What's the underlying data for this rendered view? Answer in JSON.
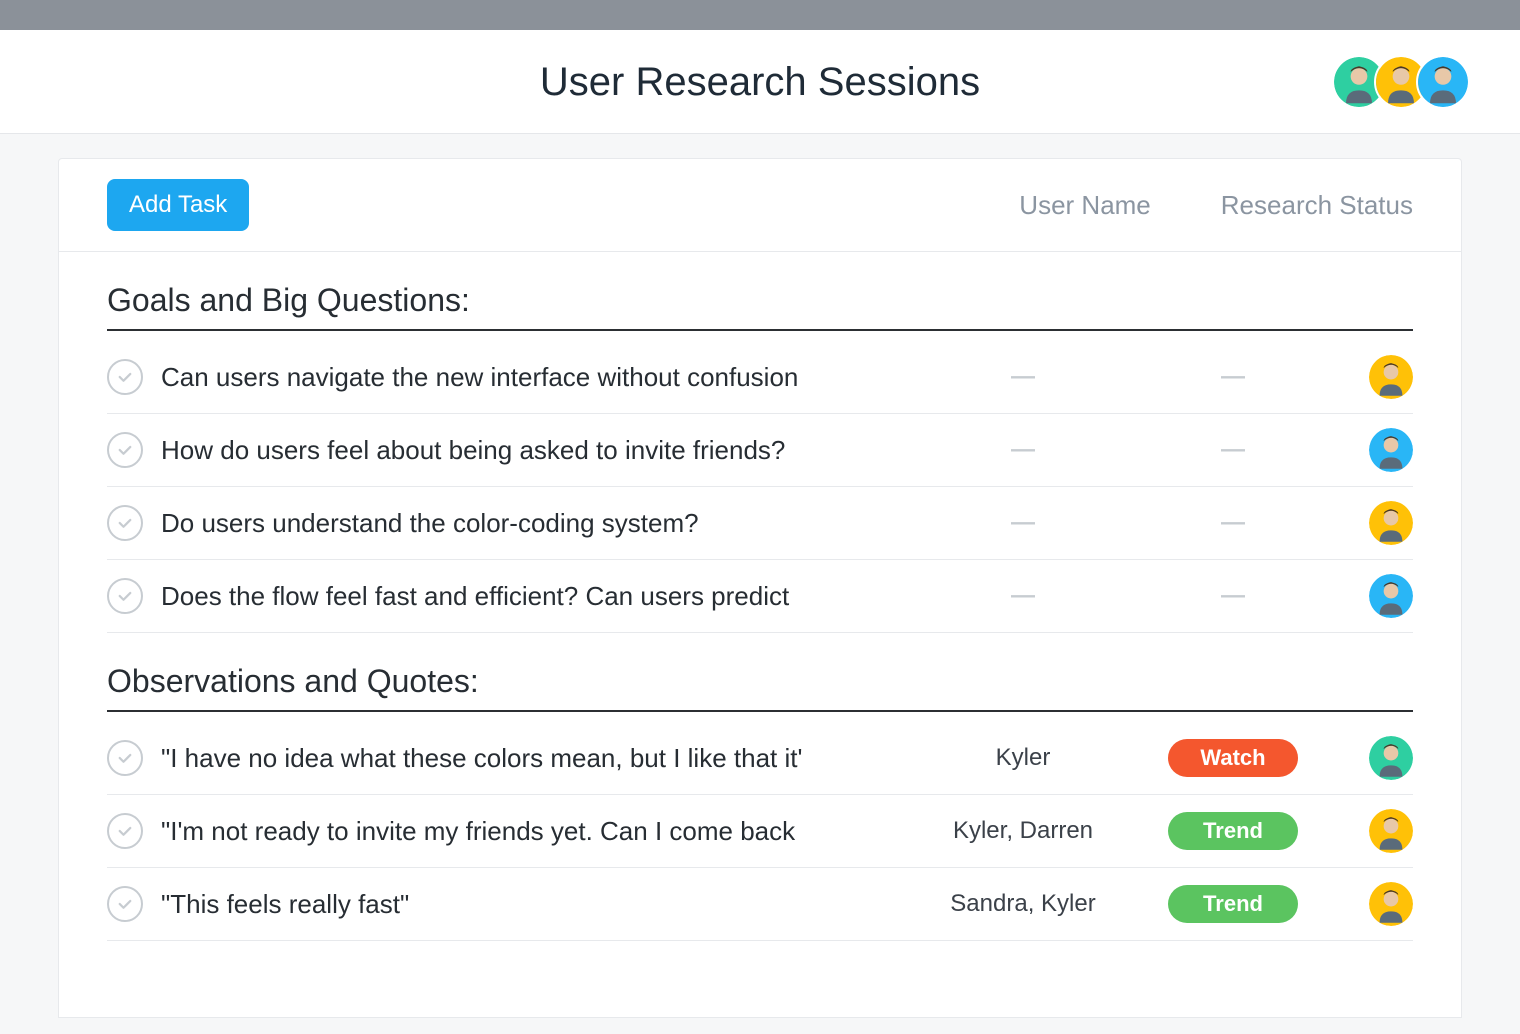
{
  "header": {
    "title": "User Research Sessions"
  },
  "card": {
    "add_task_label": "Add Task",
    "columns": {
      "user_name": "User Name",
      "research_status": "Research Status"
    }
  },
  "avatars": {
    "green": "#2ecfa1",
    "yellow": "#ffc107",
    "blue": "#29b6f6"
  },
  "status_colors": {
    "Watch": "#f4572e",
    "Trend": "#5bc460"
  },
  "sections": [
    {
      "title": "Goals and Big Questions:",
      "tasks": [
        {
          "title": "Can users navigate the new interface without confusion",
          "user": "",
          "status": "",
          "assignee_color": "yellow"
        },
        {
          "title": "How do users feel about being asked to invite friends?",
          "user": "",
          "status": "",
          "assignee_color": "blue"
        },
        {
          "title": "Do users understand the color-coding system?",
          "user": "",
          "status": "",
          "assignee_color": "yellow"
        },
        {
          "title": "Does the flow feel fast and efficient? Can users predict",
          "user": "",
          "status": "",
          "assignee_color": "blue"
        }
      ]
    },
    {
      "title": "Observations and Quotes:",
      "tasks": [
        {
          "title": "\"I have no idea what these colors mean, but I like that it'",
          "user": "Kyler",
          "status": "Watch",
          "assignee_color": "green"
        },
        {
          "title": "\"I'm not ready to invite my friends yet. Can I come back",
          "user": "Kyler, Darren",
          "status": "Trend",
          "assignee_color": "yellow"
        },
        {
          "title": "\"This feels really fast\"",
          "user": "Sandra, Kyler",
          "status": "Trend",
          "assignee_color": "yellow"
        }
      ]
    }
  ]
}
